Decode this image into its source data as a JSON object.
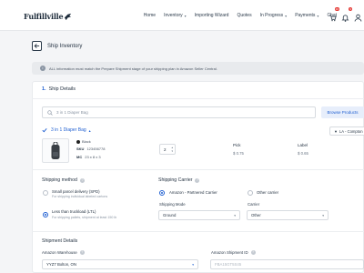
{
  "brand": {
    "logo_text": "Fulfillville",
    "accent": "#1f5fd1"
  },
  "nav": {
    "items": [
      {
        "label": "Home",
        "dropdown": false
      },
      {
        "label": "Inventory",
        "dropdown": true
      },
      {
        "label": "Importing Wizard",
        "dropdown": false
      },
      {
        "label": "Quotes",
        "dropdown": false
      },
      {
        "label": "In Progress",
        "dropdown": true
      },
      {
        "label": "Payments",
        "dropdown": true
      },
      {
        "label": "Chat",
        "dropdown": false
      }
    ],
    "cart_badge": "10",
    "bell_badge": "9"
  },
  "page": {
    "title": "Ship Inventory"
  },
  "info": {
    "icon": "info-icon",
    "text": "ALL information must match the Prepare Shipment stage of your shipping plan in Amazon Seller Central."
  },
  "ship_details": {
    "number": "1.",
    "title": "Ship Details",
    "search_placeholder": "3 in 1 Diaper Bag",
    "browse_label": "Browse Products",
    "location_label": "LA - Compton",
    "product": {
      "name": "3 in 1 Diaper Bag",
      "color": "Black",
      "sku_label": "SKU",
      "sku": "123456778",
      "mc_label": "MC",
      "mc": "23 x 8 x 3",
      "qty": "2",
      "pick_label": "Pick",
      "pick_value": "$ 0.75",
      "label_label": "Label",
      "label_value": "$ 0.65"
    }
  },
  "shipping_method": {
    "title": "Shipping method",
    "options": [
      {
        "label": "Small parcel delivery (SPD)",
        "sub": "For shipping individual labeled cartons",
        "selected": false
      },
      {
        "label": "Less than truckload (LTL)",
        "sub": "For shipping pallets, shipment at least 150 lb",
        "selected": true
      }
    ]
  },
  "shipping_carrier": {
    "title": "Shipping Carrier",
    "options": [
      {
        "label": "Amazon - Partnered Carrier",
        "selected": true
      },
      {
        "label": "Other carrier",
        "selected": false
      }
    ],
    "mode_label": "Shipping Mode",
    "mode_value": "Ground",
    "carrier_label": "Carrier",
    "carrier_value": "Other"
  },
  "shipment_details": {
    "title": "Shipment Details",
    "warehouse_label": "Amazon Warehouse",
    "warehouse_value": "YYZ7 Bolton, ON",
    "shipment_id_label": "Amazon Shipment ID",
    "shipment_id_placeholder": "FBA15GT5S45"
  }
}
